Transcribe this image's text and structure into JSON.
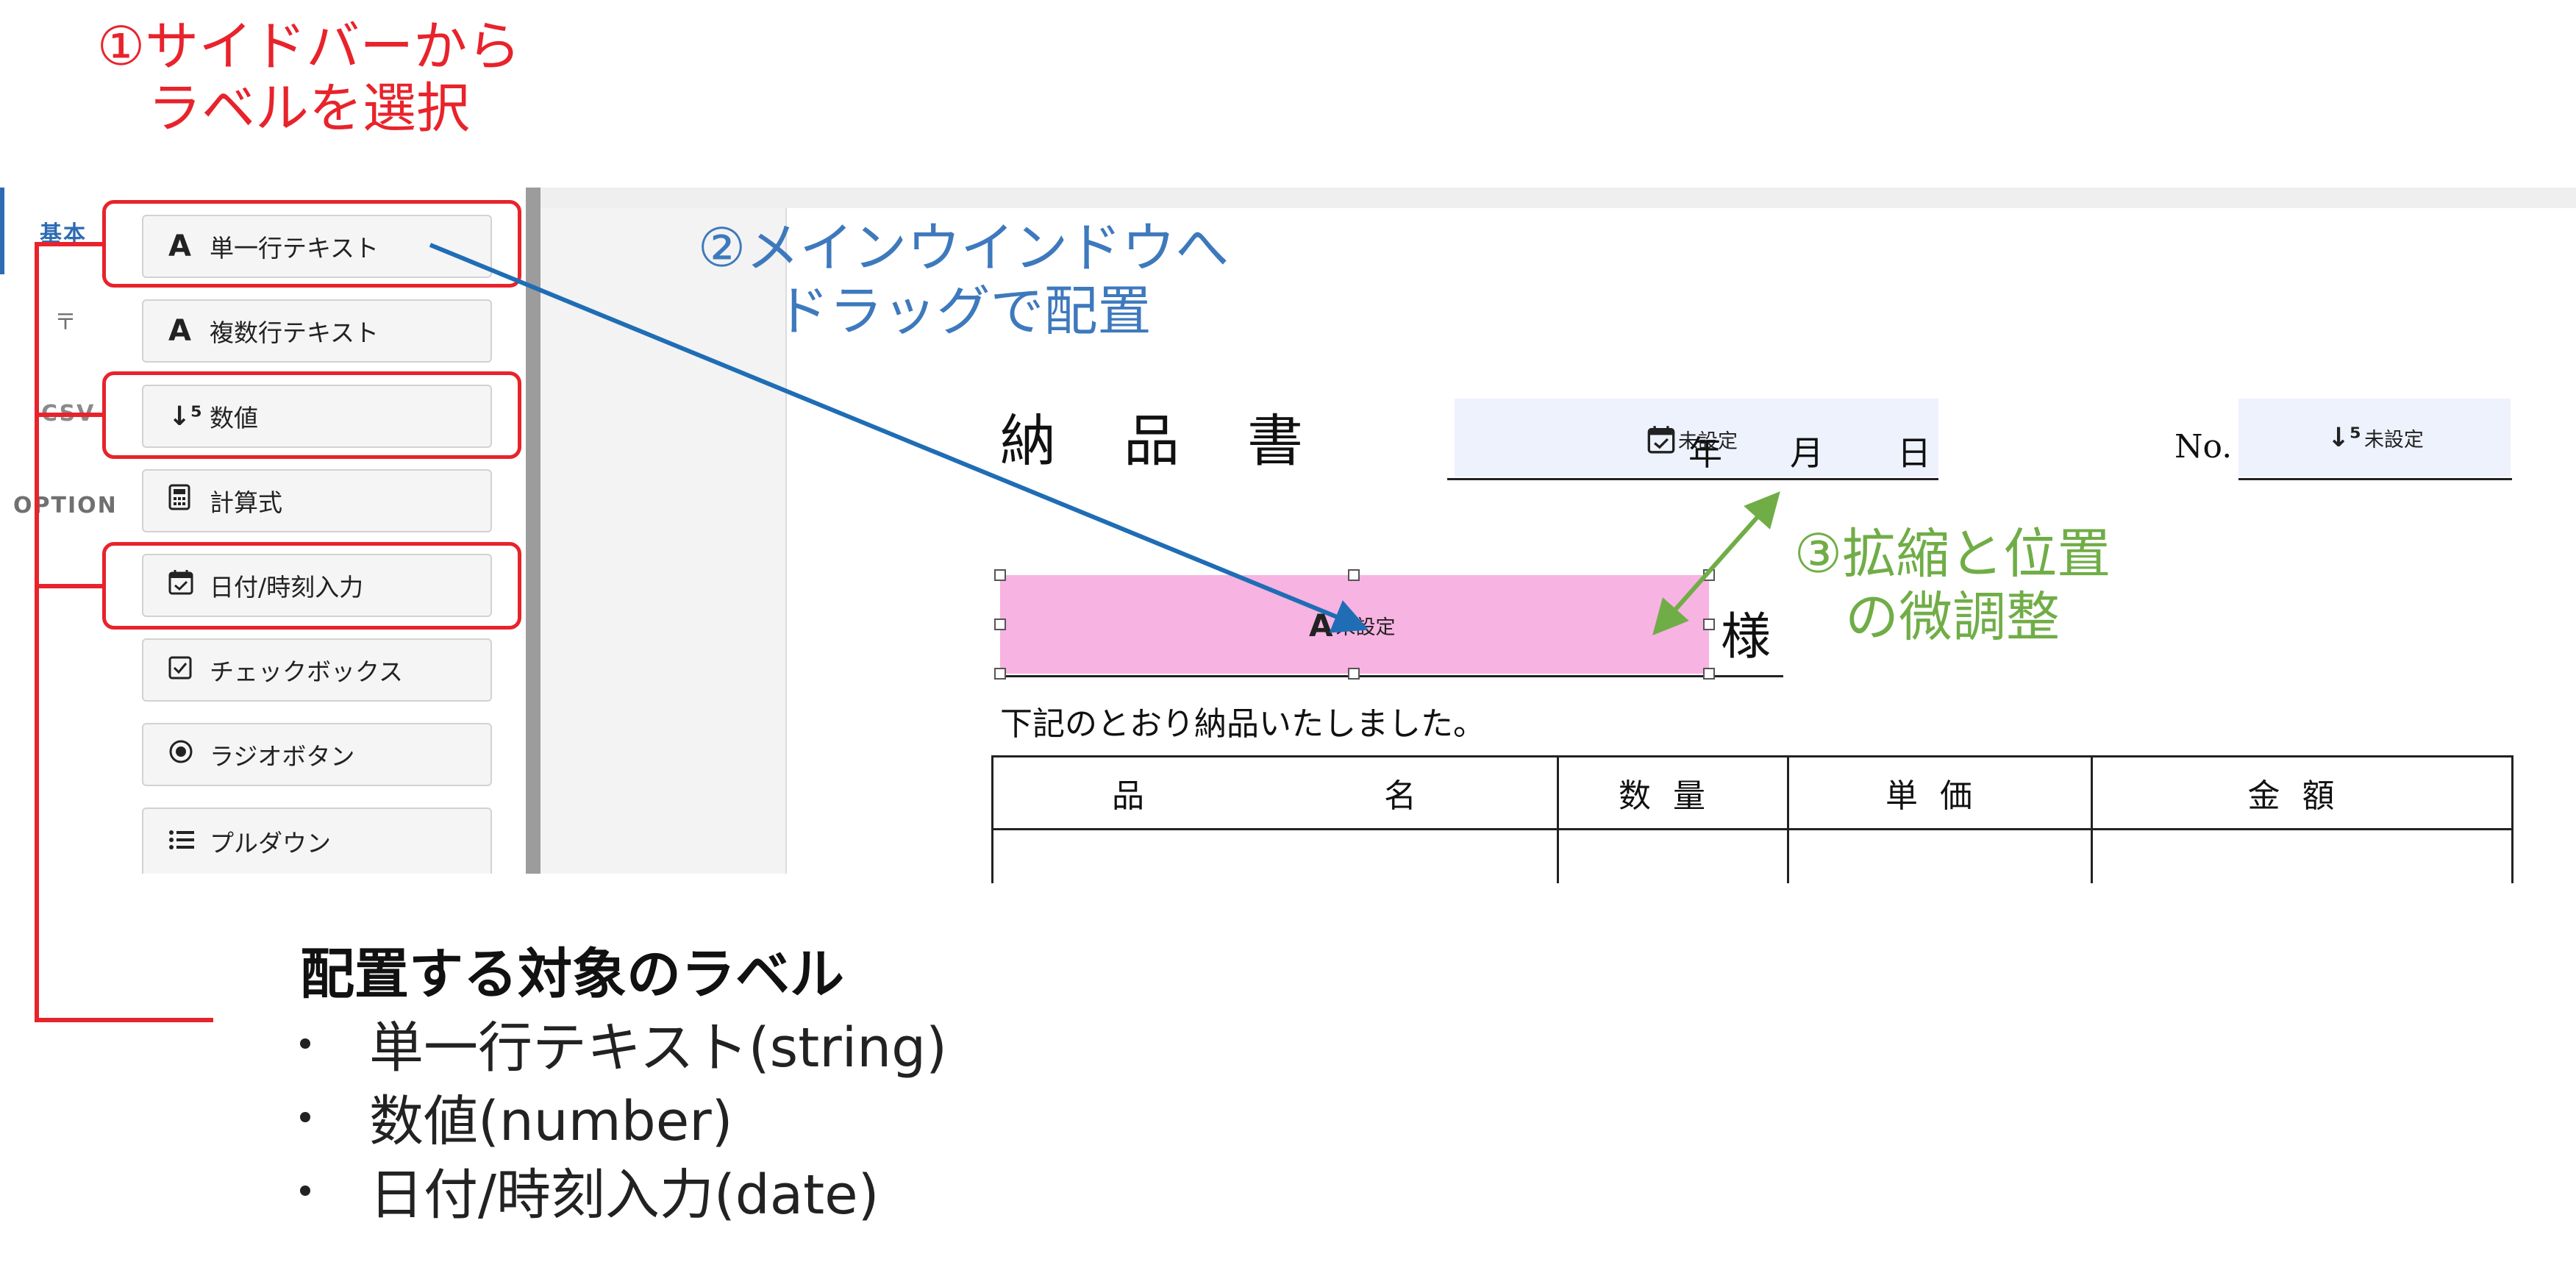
{
  "annotations": {
    "step1": [
      "①サイドバーから",
      "ラベルを選択"
    ],
    "step2": [
      "②メインウインドウへ",
      "ドラッグで配置"
    ],
    "step3": [
      "③拡縮と位置",
      "の微調整"
    ]
  },
  "sidebar": {
    "tabs": [
      "基本",
      "〒",
      "CSV",
      "OPTION"
    ],
    "active_tab": "基本",
    "items": [
      {
        "icon": "text-icon",
        "label": "単一行テキスト",
        "highlighted": true
      },
      {
        "icon": "text-icon",
        "label": "複数行テキスト",
        "highlighted": false
      },
      {
        "icon": "number-icon",
        "label": "数値",
        "highlighted": true
      },
      {
        "icon": "calculator-icon",
        "label": "計算式",
        "highlighted": false
      },
      {
        "icon": "calendar-icon",
        "label": "日付/時刻入力",
        "highlighted": true
      },
      {
        "icon": "checkbox-icon",
        "label": "チェックボックス",
        "highlighted": false
      },
      {
        "icon": "radio-icon",
        "label": "ラジオボタン",
        "highlighted": false
      },
      {
        "icon": "list-icon",
        "label": "プルダウン",
        "highlighted": false
      }
    ]
  },
  "document": {
    "title": "納　品　書",
    "date_field": "未設定",
    "date_year": "年",
    "date_month": "月",
    "date_day": "日",
    "no_label": "No.",
    "no_field": "未設定",
    "customer_field": "未設定",
    "customer_suffix": "様",
    "message": "下記のとおり納品いたしました。",
    "table_headers": [
      "品　　　　名",
      "数量",
      "単価",
      "金額"
    ]
  },
  "legend": {
    "title": "配置する対象のラベル",
    "items": [
      "単一行テキスト(string)",
      "数値(number)",
      "日付/時刻入力(date)"
    ]
  },
  "colors": {
    "red": "#e8232b",
    "blue": "#3e79bd",
    "green": "#70ad47",
    "selected_field": "#f7b3e2",
    "field_bg": "#eef2fc"
  }
}
